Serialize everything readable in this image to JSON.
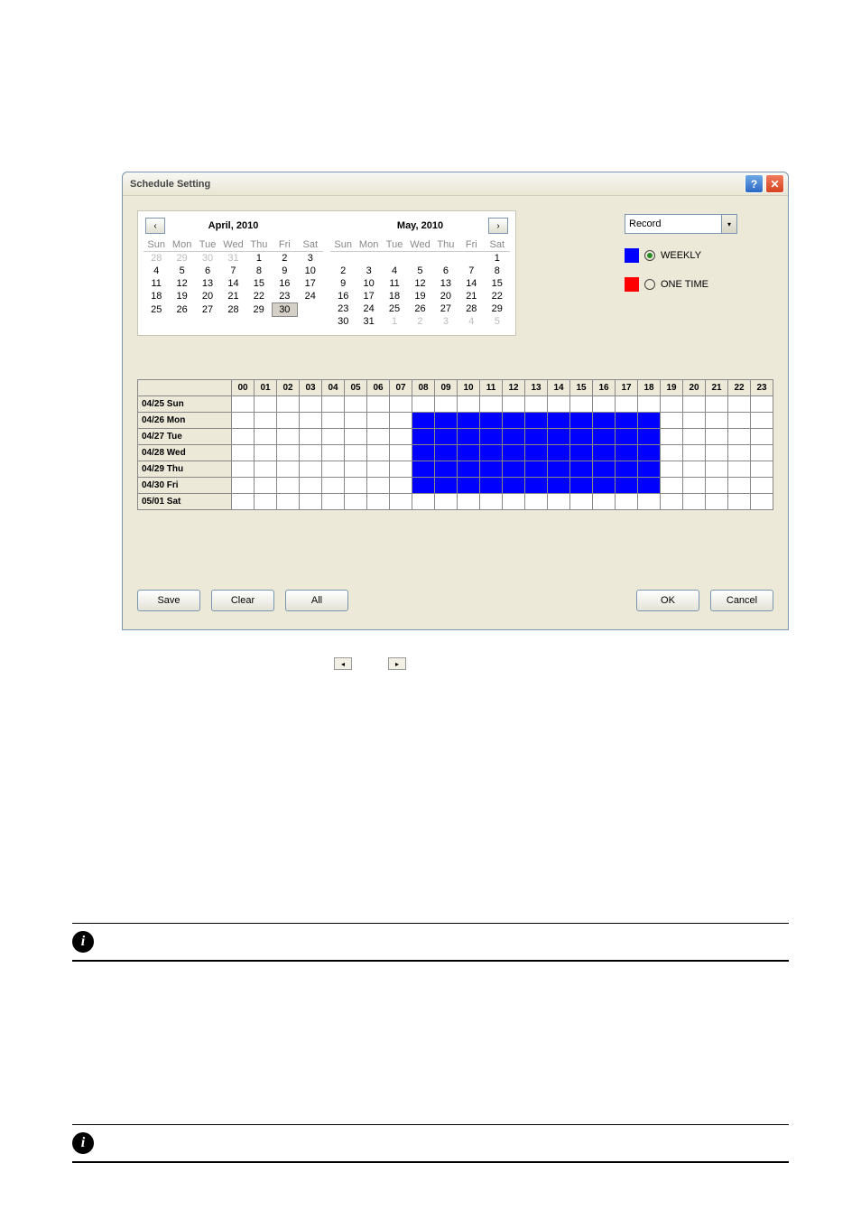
{
  "dialog": {
    "title": "Schedule Setting"
  },
  "calendars": {
    "left": {
      "title": "April, 2010",
      "dow": [
        "Sun",
        "Mon",
        "Tue",
        "Wed",
        "Thu",
        "Fri",
        "Sat"
      ],
      "rows": [
        [
          {
            "d": "28",
            "dim": true
          },
          {
            "d": "29",
            "dim": true
          },
          {
            "d": "30",
            "dim": true
          },
          {
            "d": "31",
            "dim": true
          },
          {
            "d": "1"
          },
          {
            "d": "2"
          },
          {
            "d": "3"
          }
        ],
        [
          {
            "d": "4"
          },
          {
            "d": "5"
          },
          {
            "d": "6"
          },
          {
            "d": "7"
          },
          {
            "d": "8"
          },
          {
            "d": "9"
          },
          {
            "d": "10"
          }
        ],
        [
          {
            "d": "11"
          },
          {
            "d": "12"
          },
          {
            "d": "13"
          },
          {
            "d": "14"
          },
          {
            "d": "15"
          },
          {
            "d": "16"
          },
          {
            "d": "17"
          }
        ],
        [
          {
            "d": "18"
          },
          {
            "d": "19"
          },
          {
            "d": "20"
          },
          {
            "d": "21"
          },
          {
            "d": "22"
          },
          {
            "d": "23"
          },
          {
            "d": "24"
          }
        ],
        [
          {
            "d": "25"
          },
          {
            "d": "26"
          },
          {
            "d": "27"
          },
          {
            "d": "28"
          },
          {
            "d": "29"
          },
          {
            "d": "30",
            "sel": true
          },
          {
            "d": ""
          }
        ]
      ]
    },
    "right": {
      "title": "May, 2010",
      "dow": [
        "Sun",
        "Mon",
        "Tue",
        "Wed",
        "Thu",
        "Fri",
        "Sat"
      ],
      "rows": [
        [
          {
            "d": ""
          },
          {
            "d": ""
          },
          {
            "d": ""
          },
          {
            "d": ""
          },
          {
            "d": ""
          },
          {
            "d": ""
          },
          {
            "d": "1"
          }
        ],
        [
          {
            "d": "2"
          },
          {
            "d": "3"
          },
          {
            "d": "4"
          },
          {
            "d": "5"
          },
          {
            "d": "6"
          },
          {
            "d": "7"
          },
          {
            "d": "8"
          }
        ],
        [
          {
            "d": "9"
          },
          {
            "d": "10"
          },
          {
            "d": "11"
          },
          {
            "d": "12"
          },
          {
            "d": "13"
          },
          {
            "d": "14"
          },
          {
            "d": "15"
          }
        ],
        [
          {
            "d": "16"
          },
          {
            "d": "17"
          },
          {
            "d": "18"
          },
          {
            "d": "19"
          },
          {
            "d": "20"
          },
          {
            "d": "21"
          },
          {
            "d": "22"
          }
        ],
        [
          {
            "d": "23"
          },
          {
            "d": "24"
          },
          {
            "d": "25"
          },
          {
            "d": "26"
          },
          {
            "d": "27"
          },
          {
            "d": "28"
          },
          {
            "d": "29"
          }
        ],
        [
          {
            "d": "30"
          },
          {
            "d": "31"
          },
          {
            "d": "1",
            "dim": true
          },
          {
            "d": "2",
            "dim": true
          },
          {
            "d": "3",
            "dim": true
          },
          {
            "d": "4",
            "dim": true
          },
          {
            "d": "5",
            "dim": true
          }
        ]
      ]
    }
  },
  "mode_select": {
    "value": "Record"
  },
  "radios": {
    "weekly": "WEEKLY",
    "onetime": "ONE TIME"
  },
  "schedule": {
    "hours": [
      "00",
      "01",
      "02",
      "03",
      "04",
      "05",
      "06",
      "07",
      "08",
      "09",
      "10",
      "11",
      "12",
      "13",
      "14",
      "15",
      "16",
      "17",
      "18",
      "19",
      "20",
      "21",
      "22",
      "23"
    ],
    "rows": [
      {
        "label": "04/25 Sun",
        "blue": []
      },
      {
        "label": "04/26 Mon",
        "blue": [
          8,
          9,
          10,
          11,
          12,
          13,
          14,
          15,
          16,
          17,
          18
        ]
      },
      {
        "label": "04/27 Tue",
        "blue": [
          8,
          9,
          10,
          11,
          12,
          13,
          14,
          15,
          16,
          17,
          18
        ]
      },
      {
        "label": "04/28 Wed",
        "blue": [
          8,
          9,
          10,
          11,
          12,
          13,
          14,
          15,
          16,
          17,
          18
        ]
      },
      {
        "label": "04/29 Thu",
        "blue": [
          8,
          9,
          10,
          11,
          12,
          13,
          14,
          15,
          16,
          17,
          18
        ]
      },
      {
        "label": "04/30 Fri",
        "blue": [
          8,
          9,
          10,
          11,
          12,
          13,
          14,
          15,
          16,
          17,
          18
        ]
      },
      {
        "label": "05/01 Sat",
        "blue": []
      }
    ]
  },
  "buttons": {
    "save": "Save",
    "clear": "Clear",
    "all": "All",
    "ok": "OK",
    "cancel": "Cancel"
  },
  "icons": {
    "prev": "‹",
    "next": "›",
    "help": "?",
    "close": "✕",
    "info": "i",
    "caret": "▾",
    "tri_left": "◂",
    "tri_right": "▸"
  }
}
